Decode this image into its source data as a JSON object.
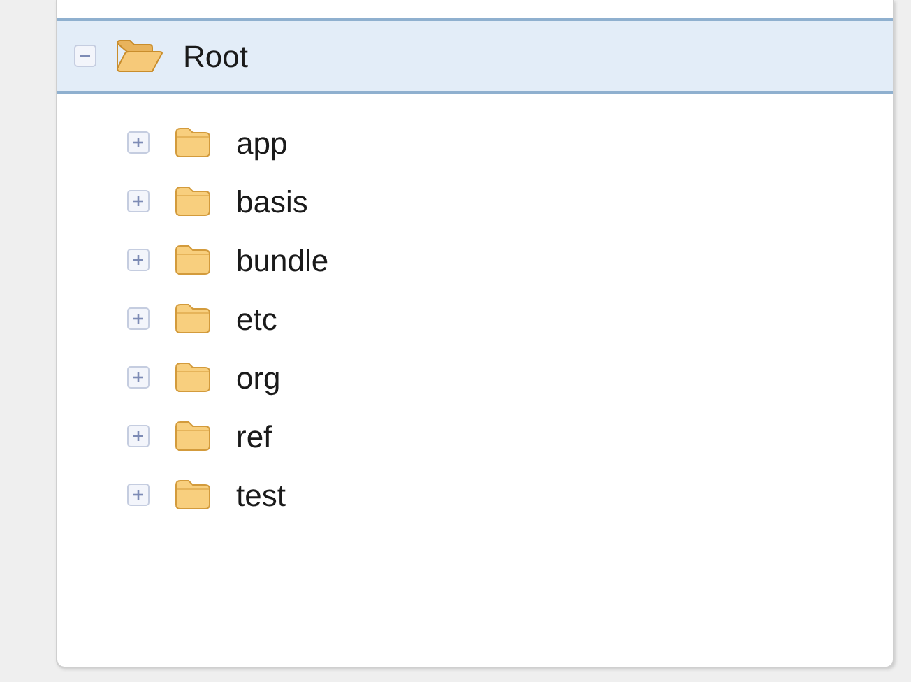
{
  "tree": [
    {
      "label": "Root",
      "expanded": true,
      "selected": true,
      "children": [
        {
          "label": "app",
          "expanded": false,
          "selected": false
        },
        {
          "label": "basis",
          "expanded": false,
          "selected": false
        },
        {
          "label": "bundle",
          "expanded": false,
          "selected": false
        },
        {
          "label": "etc",
          "expanded": false,
          "selected": false
        },
        {
          "label": "org",
          "expanded": false,
          "selected": false
        },
        {
          "label": "ref",
          "expanded": false,
          "selected": false
        },
        {
          "label": "test",
          "expanded": false,
          "selected": false
        }
      ]
    }
  ]
}
